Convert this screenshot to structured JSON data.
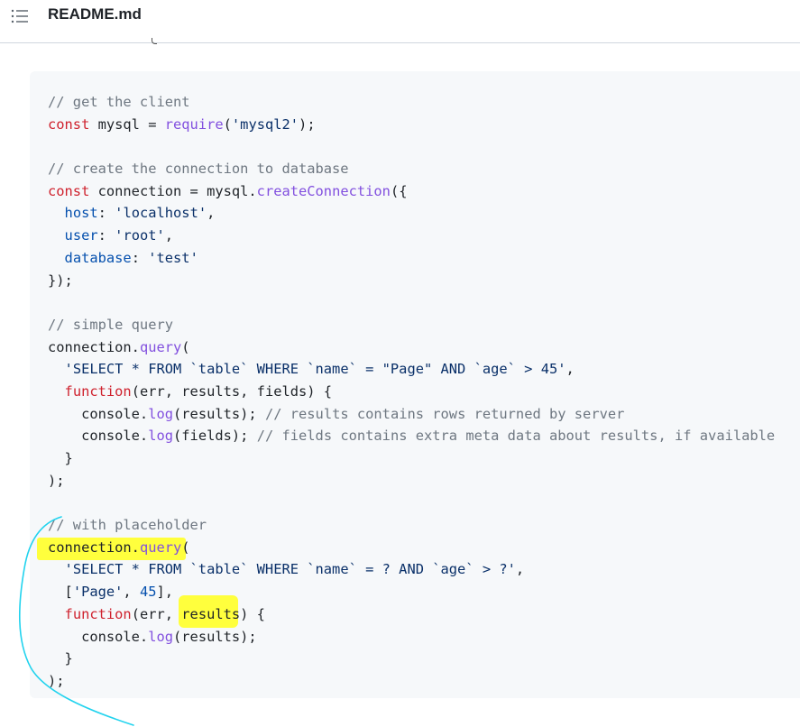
{
  "header": {
    "filename": "README.md"
  },
  "icons": {
    "list": "list-icon"
  },
  "colors": {
    "comment": "#6e7781",
    "keyword": "#cf222e",
    "function": "#8250df",
    "string": "#0a3069",
    "property": "#0550ae",
    "highlight": "#ffff33",
    "pen": "#22d3ee"
  },
  "code": {
    "l1": {
      "t0": "// get the client"
    },
    "l2": {
      "t0": "const",
      "t1": " mysql = ",
      "t2": "require",
      "t3": "(",
      "t4": "'mysql2'",
      "t5": ");"
    },
    "l4": {
      "t0": "// create the connection to database"
    },
    "l5": {
      "t0": "const",
      "t1": " connection = mysql.",
      "t2": "createConnection",
      "t3": "({"
    },
    "l6": {
      "t0": "  ",
      "t1": "host",
      "t2": ": ",
      "t3": "'localhost'",
      "t4": ","
    },
    "l7": {
      "t0": "  ",
      "t1": "user",
      "t2": ": ",
      "t3": "'root'",
      "t4": ","
    },
    "l8": {
      "t0": "  ",
      "t1": "database",
      "t2": ": ",
      "t3": "'test'"
    },
    "l9": {
      "t0": "});"
    },
    "l11": {
      "t0": "// simple query"
    },
    "l12": {
      "t0": "connection.",
      "t1": "query",
      "t2": "("
    },
    "l13": {
      "t0": "  ",
      "t1": "'SELECT * FROM `table` WHERE `name` = \"Page\" AND `age` > 45'",
      "t2": ","
    },
    "l14": {
      "t0": "  ",
      "t1": "function",
      "t2": "(err, results, fields) {"
    },
    "l15": {
      "t0": "    console.",
      "t1": "log",
      "t2": "(results); ",
      "t3": "// results contains rows returned by server"
    },
    "l16": {
      "t0": "    console.",
      "t1": "log",
      "t2": "(fields); ",
      "t3": "// fields contains extra meta data about results, if available"
    },
    "l17": {
      "t0": "  }"
    },
    "l18": {
      "t0": ");"
    },
    "l20": {
      "t0": "// with placeholder"
    },
    "l21": {
      "t0": "connection.",
      "t1": "query",
      "t2": "("
    },
    "l22": {
      "t0": "  ",
      "t1": "'SELECT * FROM `table` WHERE `name` = ? AND `age` > ?'",
      "t2": ","
    },
    "l23": {
      "t0": "  [",
      "t1": "'Page'",
      "t2": ", ",
      "t3": "45",
      "t4": "],"
    },
    "l24": {
      "t0": "  ",
      "t1": "function",
      "t2": "(err, results) {"
    },
    "l25": {
      "t0": "    console.",
      "t1": "log",
      "t2": "(results);"
    },
    "l26": {
      "t0": "  }"
    },
    "l27": {
      "t0": ");"
    }
  }
}
